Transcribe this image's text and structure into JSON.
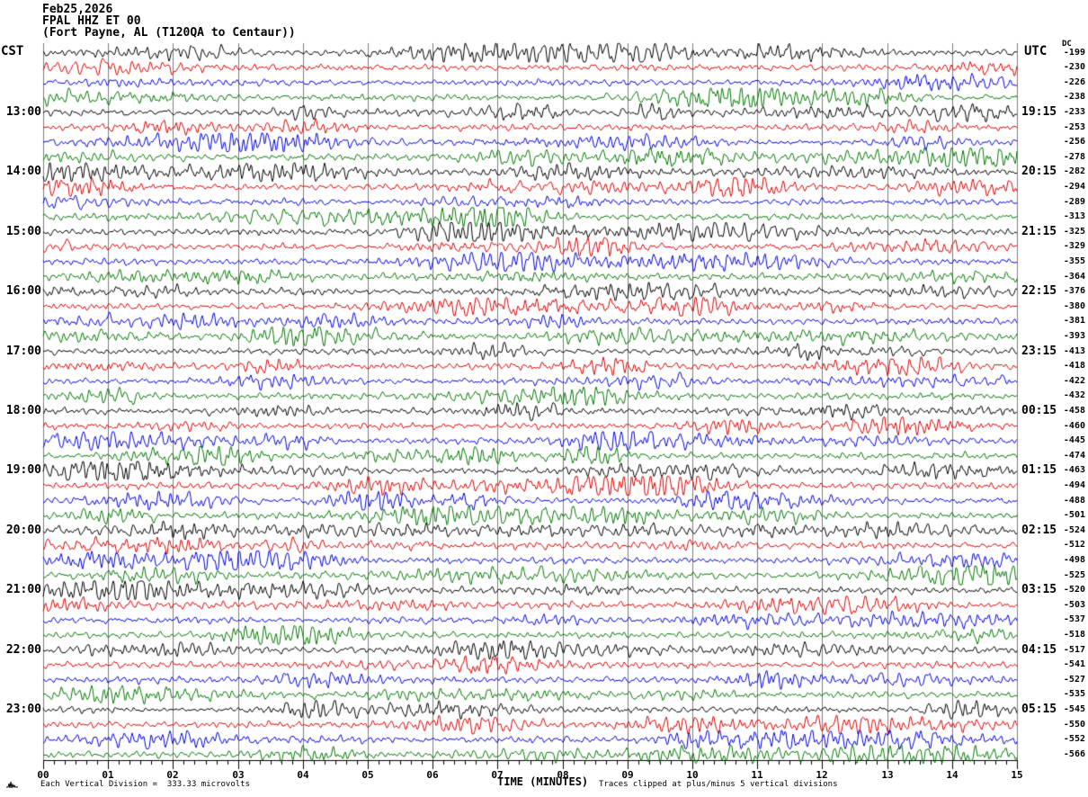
{
  "title": {
    "date": "Feb25,2026",
    "station": "FPAL HHZ ET 00",
    "location": "(Fort Payne, AL (T120QA to Centaur))"
  },
  "corner_labels": {
    "left_timezone": "CST",
    "right_timezone": "UTC",
    "dc_header": "DC"
  },
  "x_axis": {
    "title": "TIME (MINUTES)",
    "tick_labels": [
      "00",
      "01",
      "02",
      "03",
      "04",
      "05",
      "06",
      "07",
      "08",
      "09",
      "10",
      "11",
      "12",
      "13",
      "14",
      "15"
    ]
  },
  "footer": {
    "scale_note": "Each Vertical Division =  333.33 microvolts",
    "clip_note": "Traces clipped at plus/minus 5 vertical divisions"
  },
  "chart_data": {
    "type": "line",
    "subtype": "helicorder-seismogram",
    "minutes_per_row": 15,
    "grid": "vertical gridline each minute",
    "grid_color": "#7d7d7d",
    "trace_color_cycle": [
      "#000000",
      "#dd0000",
      "#0000dd",
      "#007700"
    ],
    "clip_divisions": 5,
    "microvolts_per_division": "333.33",
    "rows": [
      {
        "cst": "",
        "utc": "",
        "dc": "-199"
      },
      {
        "cst": "",
        "utc": "",
        "dc": "-230"
      },
      {
        "cst": "",
        "utc": "",
        "dc": "-226"
      },
      {
        "cst": "",
        "utc": "",
        "dc": "-238"
      },
      {
        "cst": "13:00",
        "utc": "19:15",
        "dc": "-233"
      },
      {
        "cst": "",
        "utc": "",
        "dc": "-253"
      },
      {
        "cst": "",
        "utc": "",
        "dc": "-256"
      },
      {
        "cst": "",
        "utc": "",
        "dc": "-278"
      },
      {
        "cst": "14:00",
        "utc": "20:15",
        "dc": "-282"
      },
      {
        "cst": "",
        "utc": "",
        "dc": "-294"
      },
      {
        "cst": "",
        "utc": "",
        "dc": "-289"
      },
      {
        "cst": "",
        "utc": "",
        "dc": "-313"
      },
      {
        "cst": "15:00",
        "utc": "21:15",
        "dc": "-325"
      },
      {
        "cst": "",
        "utc": "",
        "dc": "-329"
      },
      {
        "cst": "",
        "utc": "",
        "dc": "-355"
      },
      {
        "cst": "",
        "utc": "",
        "dc": "-364"
      },
      {
        "cst": "16:00",
        "utc": "22:15",
        "dc": "-376"
      },
      {
        "cst": "",
        "utc": "",
        "dc": "-380"
      },
      {
        "cst": "",
        "utc": "",
        "dc": "-381"
      },
      {
        "cst": "",
        "utc": "",
        "dc": "-393"
      },
      {
        "cst": "17:00",
        "utc": "23:15",
        "dc": "-413"
      },
      {
        "cst": "",
        "utc": "",
        "dc": "-418"
      },
      {
        "cst": "",
        "utc": "",
        "dc": "-422"
      },
      {
        "cst": "",
        "utc": "",
        "dc": "-432"
      },
      {
        "cst": "18:00",
        "utc": "00:15",
        "dc": "-458"
      },
      {
        "cst": "",
        "utc": "",
        "dc": "-460"
      },
      {
        "cst": "",
        "utc": "",
        "dc": "-445"
      },
      {
        "cst": "",
        "utc": "",
        "dc": "-474"
      },
      {
        "cst": "19:00",
        "utc": "01:15",
        "dc": "-463"
      },
      {
        "cst": "",
        "utc": "",
        "dc": "-494"
      },
      {
        "cst": "",
        "utc": "",
        "dc": "-488"
      },
      {
        "cst": "",
        "utc": "",
        "dc": "-501"
      },
      {
        "cst": "20:00",
        "utc": "02:15",
        "dc": "-524"
      },
      {
        "cst": "",
        "utc": "",
        "dc": "-512"
      },
      {
        "cst": "",
        "utc": "",
        "dc": "-498"
      },
      {
        "cst": "",
        "utc": "",
        "dc": "-525"
      },
      {
        "cst": "21:00",
        "utc": "03:15",
        "dc": "-520"
      },
      {
        "cst": "",
        "utc": "",
        "dc": "-503"
      },
      {
        "cst": "",
        "utc": "",
        "dc": "-537"
      },
      {
        "cst": "",
        "utc": "",
        "dc": "-518"
      },
      {
        "cst": "22:00",
        "utc": "04:15",
        "dc": "-517"
      },
      {
        "cst": "",
        "utc": "",
        "dc": "-541"
      },
      {
        "cst": "",
        "utc": "",
        "dc": "-527"
      },
      {
        "cst": "",
        "utc": "",
        "dc": "-535"
      },
      {
        "cst": "23:00",
        "utc": "05:15",
        "dc": "-545"
      },
      {
        "cst": "",
        "utc": "",
        "dc": "-550"
      },
      {
        "cst": "",
        "utc": "",
        "dc": "-552"
      },
      {
        "cst": "",
        "utc": "",
        "dc": "-566"
      }
    ]
  }
}
